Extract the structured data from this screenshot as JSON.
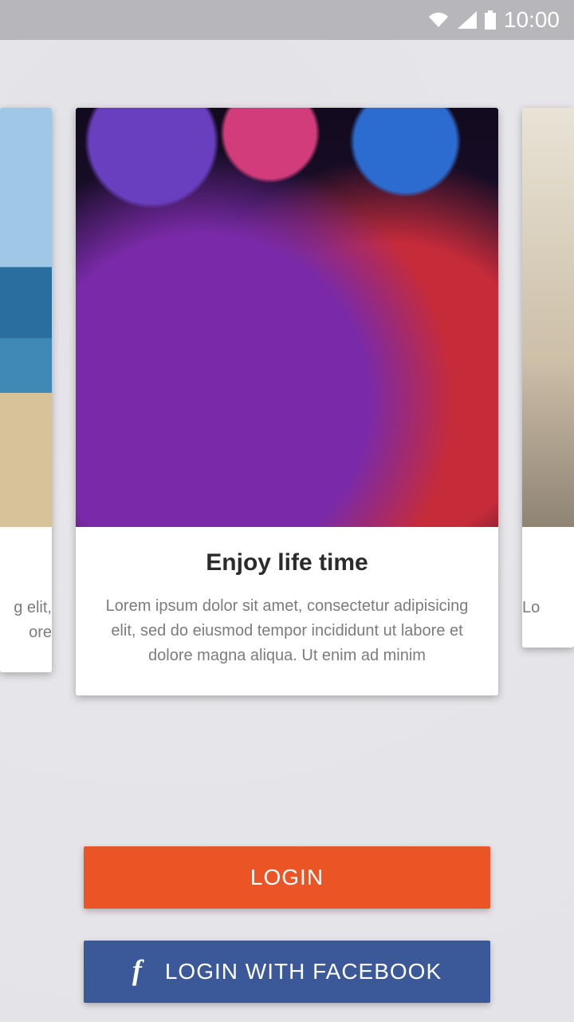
{
  "status": {
    "time": "10:00"
  },
  "carousel": {
    "left": {
      "body_tail": "g elit,\nore"
    },
    "center": {
      "title": "Enjoy life time",
      "body": "Lorem ipsum dolor sit amet, consectetur adipisicing elit, sed do eiusmod tempor incididunt ut labore et dolore magna aliqua. Ut enim ad minim"
    },
    "right": {
      "body_head": "Lo"
    }
  },
  "buttons": {
    "login": "LOGIN",
    "facebook": "LOGIN WITH FACEBOOK"
  },
  "colors": {
    "accent": "#eb5424",
    "facebook": "#3b5998"
  }
}
